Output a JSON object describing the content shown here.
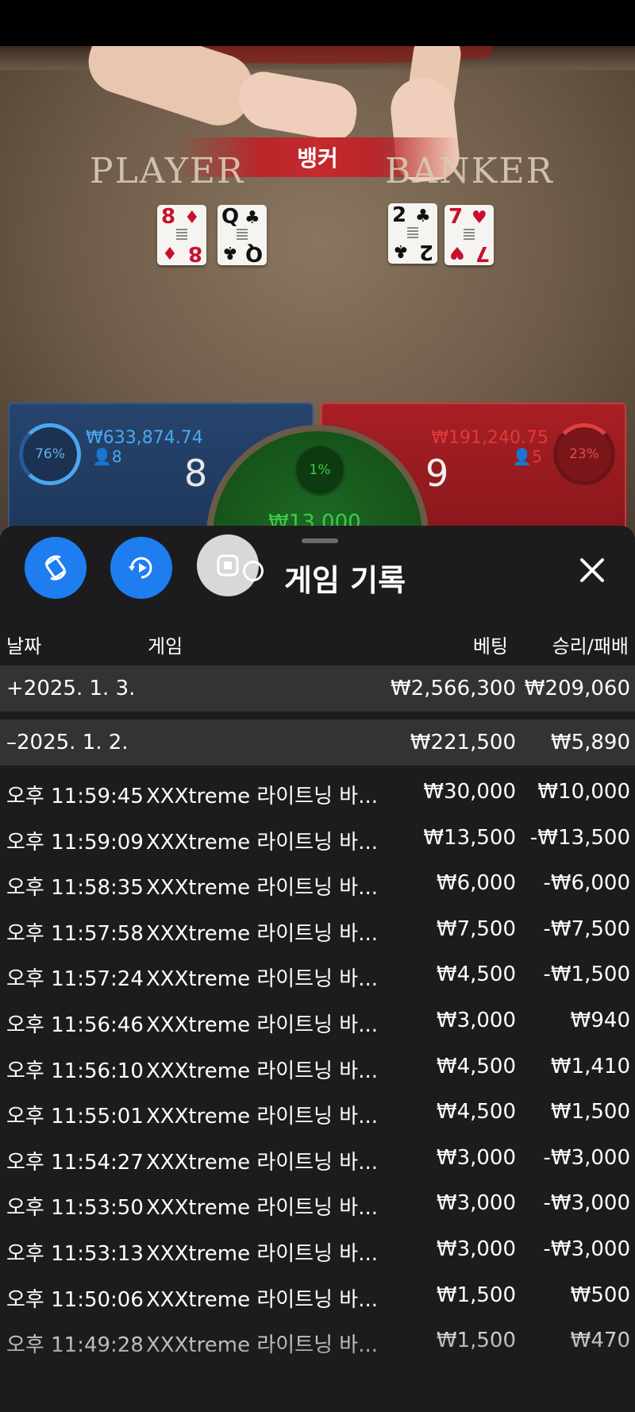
{
  "video": {
    "winner_banner": "뱅커",
    "player_label": "PLAYER",
    "banker_label": "BANKER",
    "player_cards": [
      {
        "rank": "8",
        "suit": "♦",
        "color": "red"
      },
      {
        "rank": "Q",
        "suit": "♣",
        "color": "black"
      }
    ],
    "banker_cards": [
      {
        "rank": "2",
        "suit": "♣",
        "color": "black"
      },
      {
        "rank": "7",
        "suit": "♥",
        "color": "red"
      }
    ]
  },
  "bet_panel": {
    "player": {
      "percent": "76%",
      "amount": "₩633,874.74",
      "count": "8",
      "score": "8"
    },
    "banker": {
      "percent": "23%",
      "amount": "₩191,240.75",
      "count": "5",
      "score": "9"
    },
    "tie": {
      "percent": "1%",
      "amount": "₩13,000"
    }
  },
  "sheet": {
    "title": "게임 기록",
    "columns": {
      "date": "날짜",
      "game": "게임",
      "bet": "베팅",
      "result": "승리/패배"
    },
    "days": [
      {
        "toggle": "+",
        "date": "2025. 1. 3.",
        "bet": "₩2,566,300",
        "result": "₩209,060"
      },
      {
        "toggle": "–",
        "date": "2025. 1. 2.",
        "bet": "₩221,500",
        "result": "₩5,890"
      }
    ],
    "rows": [
      {
        "time": "오후 11:59:45",
        "game": "XXXtreme 라이트닝 바...",
        "bet": "₩30,000",
        "result": "₩10,000"
      },
      {
        "time": "오후 11:59:09",
        "game": "XXXtreme 라이트닝 바...",
        "bet": "₩13,500",
        "result": "-₩13,500"
      },
      {
        "time": "오후 11:58:35",
        "game": "XXXtreme 라이트닝 바...",
        "bet": "₩6,000",
        "result": "-₩6,000"
      },
      {
        "time": "오후 11:57:58",
        "game": "XXXtreme 라이트닝 바...",
        "bet": "₩7,500",
        "result": "-₩7,500"
      },
      {
        "time": "오후 11:57:24",
        "game": "XXXtreme 라이트닝 바...",
        "bet": "₩4,500",
        "result": "-₩1,500"
      },
      {
        "time": "오후 11:56:46",
        "game": "XXXtreme 라이트닝 바...",
        "bet": "₩3,000",
        "result": "₩940"
      },
      {
        "time": "오후 11:56:10",
        "game": "XXXtreme 라이트닝 바...",
        "bet": "₩4,500",
        "result": "₩1,410"
      },
      {
        "time": "오후 11:55:01",
        "game": "XXXtreme 라이트닝 바...",
        "bet": "₩4,500",
        "result": "₩1,500"
      },
      {
        "time": "오후 11:54:27",
        "game": "XXXtreme 라이트닝 바...",
        "bet": "₩3,000",
        "result": "-₩3,000"
      },
      {
        "time": "오후 11:53:50",
        "game": "XXXtreme 라이트닝 바...",
        "bet": "₩3,000",
        "result": "-₩3,000"
      },
      {
        "time": "오후 11:53:13",
        "game": "XXXtreme 라이트닝 바...",
        "bet": "₩3,000",
        "result": "-₩3,000"
      },
      {
        "time": "오후 11:50:06",
        "game": "XXXtreme 라이트닝 바...",
        "bet": "₩1,500",
        "result": "₩500"
      },
      {
        "time": "오후 11:49:28",
        "game": "XXXtreme 라이트닝 바...",
        "bet": "₩1,500",
        "result": "₩470"
      }
    ]
  },
  "colors": {
    "accent_blue": "#1e7ef0",
    "sheet_bg": "#1c1c1e",
    "day_row_bg": "#333336",
    "player_blue": "#4aa8f0",
    "banker_red": "#e03a3a",
    "tie_green": "#3ec94a"
  },
  "icons": {
    "fab_one": "rotate-sync-icon",
    "fab_two": "replay-icon",
    "fab_three": "stop-icon",
    "history": "history-icon",
    "close": "close-icon"
  }
}
